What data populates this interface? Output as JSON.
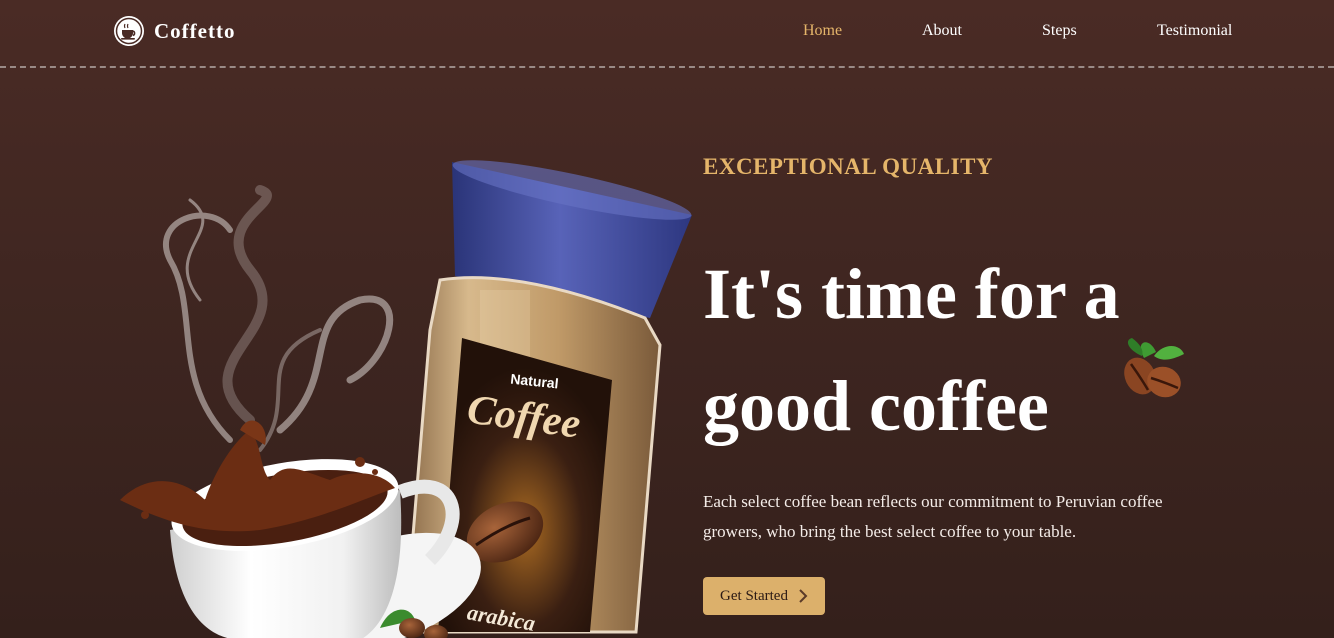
{
  "brand": {
    "name": "Coffetto",
    "icon": "coffee-cup-icon"
  },
  "nav": {
    "items": [
      {
        "label": "Home",
        "active": true
      },
      {
        "label": "About",
        "active": false
      },
      {
        "label": "Steps",
        "active": false
      },
      {
        "label": "Testimonial",
        "active": false
      }
    ]
  },
  "hero": {
    "eyebrow": "EXCEPTIONAL QUALITY",
    "headline_line1": "It's time for a",
    "headline_line2": "good coffee",
    "description": "Each select coffee bean reflects our commitment to Peruvian coffee growers, who bring the best select coffee to your table.",
    "cta_label": "Get Started",
    "jar_label_top": "Natural",
    "jar_label_main": "Coffee",
    "jar_label_bottom": "arabica"
  },
  "colors": {
    "background": "#4a2b25",
    "accent": "#e5b56a",
    "button": "#dcb06b",
    "jar_lid": "#3d4a9a"
  }
}
